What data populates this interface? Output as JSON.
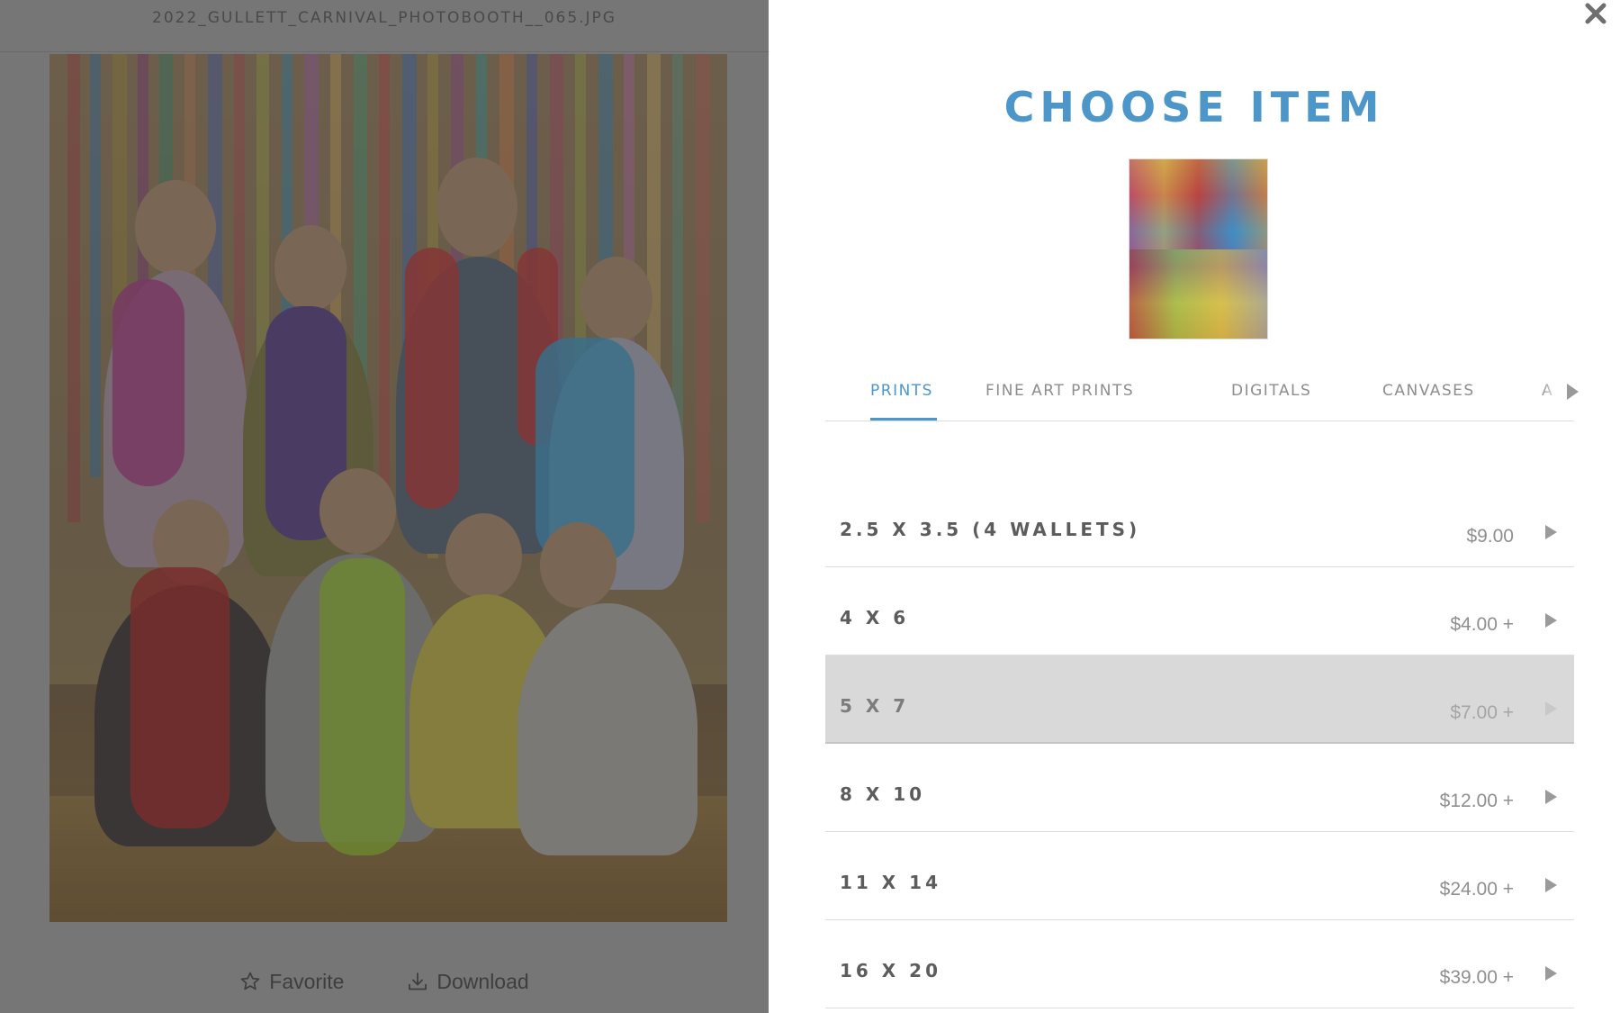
{
  "viewer": {
    "filename": "2022_GULLETT_CARNIVAL_PHOTOBOOTH__065.JPG",
    "favorite_label": "Favorite",
    "download_label": "Download"
  },
  "panel": {
    "title": "CHOOSE ITEM",
    "tabs": [
      {
        "label": "PRINTS",
        "active": true
      },
      {
        "label": "FINE ART PRINTS",
        "active": false
      },
      {
        "label": "DIGITALS",
        "active": false
      },
      {
        "label": "CANVASES",
        "active": false
      },
      {
        "label": "A",
        "active": false
      }
    ],
    "items": [
      {
        "name": "2.5 X 3.5 (4 WALLETS)",
        "price": "$9.00"
      },
      {
        "name": "4 X 6",
        "price": "$4.00 +"
      },
      {
        "name": "5 X 7",
        "price": "$7.00 +"
      },
      {
        "name": "8 X 10",
        "price": "$12.00 +"
      },
      {
        "name": "11 X 14",
        "price": "$24.00 +"
      },
      {
        "name": "16 X 20",
        "price": "$39.00 +"
      }
    ]
  },
  "colors": {
    "accent": "#4d96c9",
    "overlay": "#767676",
    "hover_row": "#d9d9d9"
  },
  "icons": [
    "close-icon",
    "star-icon",
    "download-icon",
    "chevron-right-icon"
  ]
}
